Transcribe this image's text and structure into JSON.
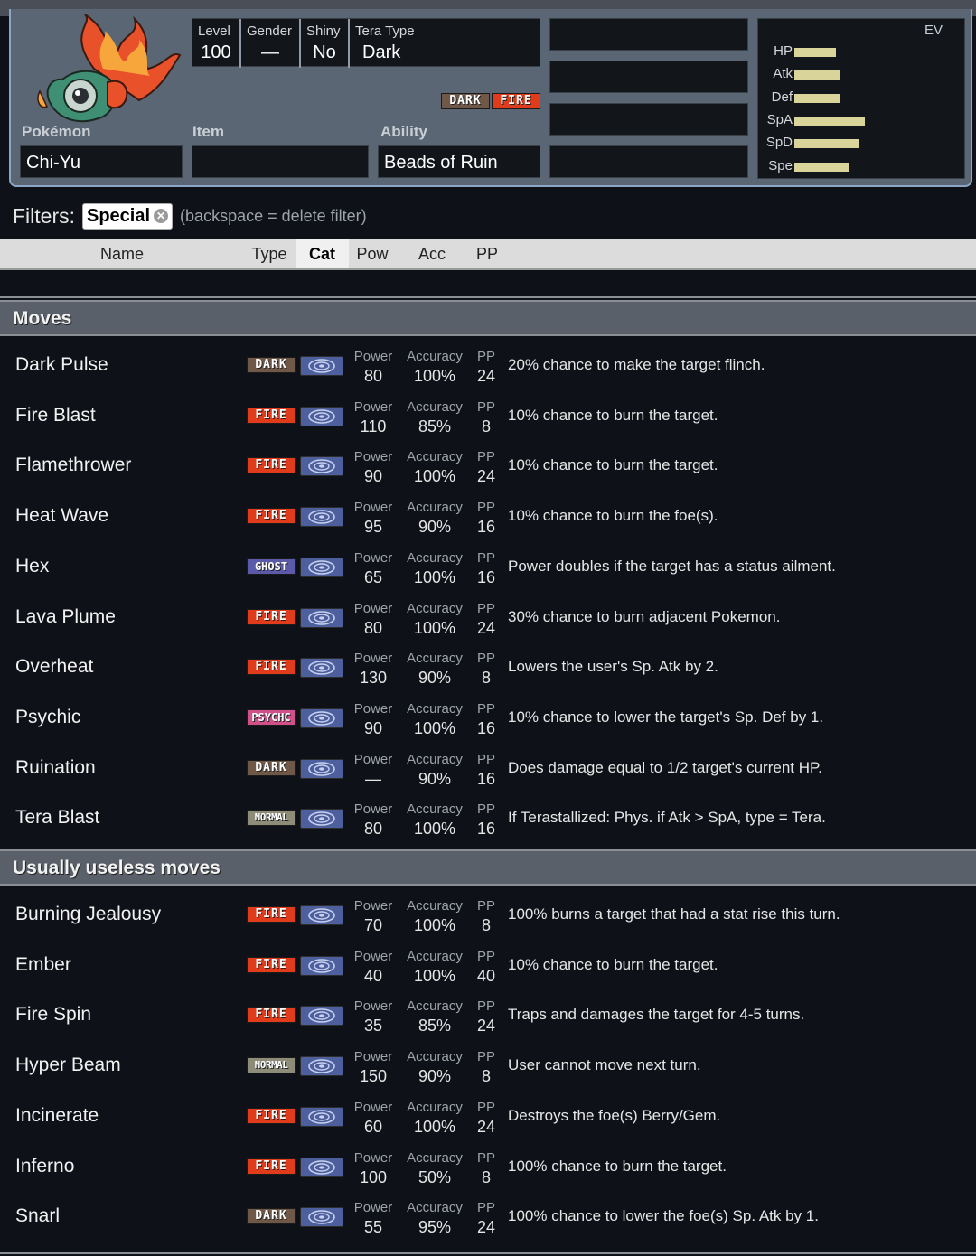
{
  "pokemon": {
    "label_pokemon": "Pokémon",
    "name": "Chi-Yu",
    "label_item": "Item",
    "item": "",
    "label_ability": "Ability",
    "ability": "Beads of Ruin",
    "types": [
      "DARK",
      "FIRE"
    ]
  },
  "details": {
    "level_label": "Level",
    "level": "100",
    "gender_label": "Gender",
    "gender": "—",
    "shiny_label": "Shiny",
    "shiny": "No",
    "tera_label": "Tera Type",
    "tera": "Dark"
  },
  "evs": {
    "header": "EV",
    "stats": [
      {
        "label": "HP",
        "level": 0.27
      },
      {
        "label": "Atk",
        "level": 0.3
      },
      {
        "label": "Def",
        "level": 0.3
      },
      {
        "label": "SpA",
        "level": 0.46
      },
      {
        "label": "SpD",
        "level": 0.42
      },
      {
        "label": "Spe",
        "level": 0.36
      }
    ]
  },
  "filters": {
    "label": "Filters:",
    "chip": "Special",
    "hint": "(backspace = delete filter)"
  },
  "sort": {
    "name": "Name",
    "type": "Type",
    "cat": "Cat",
    "pow": "Pow",
    "acc": "Acc",
    "pp": "PP"
  },
  "stat_labels": {
    "power": "Power",
    "accuracy": "Accuracy",
    "pp": "PP"
  },
  "sections": [
    {
      "title": "Moves",
      "moves": [
        {
          "name": "Dark Pulse",
          "type": "DARK",
          "power": "80",
          "accuracy": "100%",
          "pp": "24",
          "desc": "20% chance to make the target flinch."
        },
        {
          "name": "Fire Blast",
          "type": "FIRE",
          "power": "110",
          "accuracy": "85%",
          "pp": "8",
          "desc": "10% chance to burn the target."
        },
        {
          "name": "Flamethrower",
          "type": "FIRE",
          "power": "90",
          "accuracy": "100%",
          "pp": "24",
          "desc": "10% chance to burn the target."
        },
        {
          "name": "Heat Wave",
          "type": "FIRE",
          "power": "95",
          "accuracy": "90%",
          "pp": "16",
          "desc": "10% chance to burn the foe(s)."
        },
        {
          "name": "Hex",
          "type": "GHOST",
          "power": "65",
          "accuracy": "100%",
          "pp": "16",
          "desc": "Power doubles if the target has a status ailment."
        },
        {
          "name": "Lava Plume",
          "type": "FIRE",
          "power": "80",
          "accuracy": "100%",
          "pp": "24",
          "desc": "30% chance to burn adjacent Pokemon."
        },
        {
          "name": "Overheat",
          "type": "FIRE",
          "power": "130",
          "accuracy": "90%",
          "pp": "8",
          "desc": "Lowers the user's Sp. Atk by 2."
        },
        {
          "name": "Psychic",
          "type": "PSYCHC",
          "power": "90",
          "accuracy": "100%",
          "pp": "16",
          "desc": "10% chance to lower the target's Sp. Def by 1."
        },
        {
          "name": "Ruination",
          "type": "DARK",
          "power": "—",
          "accuracy": "90%",
          "pp": "16",
          "desc": "Does damage equal to 1/2 target's current HP."
        },
        {
          "name": "Tera Blast",
          "type": "NORMAL",
          "power": "80",
          "accuracy": "100%",
          "pp": "16",
          "desc": "If Terastallized: Phys. if Atk > SpA, type = Tera."
        }
      ]
    },
    {
      "title": "Usually useless moves",
      "moves": [
        {
          "name": "Burning Jealousy",
          "type": "FIRE",
          "power": "70",
          "accuracy": "100%",
          "pp": "8",
          "desc": "100% burns a target that had a stat rise this turn."
        },
        {
          "name": "Ember",
          "type": "FIRE",
          "power": "40",
          "accuracy": "100%",
          "pp": "40",
          "desc": "10% chance to burn the target."
        },
        {
          "name": "Fire Spin",
          "type": "FIRE",
          "power": "35",
          "accuracy": "85%",
          "pp": "24",
          "desc": "Traps and damages the target for 4-5 turns."
        },
        {
          "name": "Hyper Beam",
          "type": "NORMAL",
          "power": "150",
          "accuracy": "90%",
          "pp": "8",
          "desc": "User cannot move next turn."
        },
        {
          "name": "Incinerate",
          "type": "FIRE",
          "power": "60",
          "accuracy": "100%",
          "pp": "24",
          "desc": "Destroys the foe(s) Berry/Gem."
        },
        {
          "name": "Inferno",
          "type": "FIRE",
          "power": "100",
          "accuracy": "50%",
          "pp": "8",
          "desc": "100% chance to burn the target."
        },
        {
          "name": "Snarl",
          "type": "DARK",
          "power": "55",
          "accuracy": "95%",
          "pp": "24",
          "desc": "100% chance to lower the foe(s) Sp. Atk by 1."
        }
      ]
    }
  ],
  "colors": {
    "dark": "#705848",
    "fire": "#e03c1c",
    "ghost": "#5a5aa8",
    "psychic": "#d0508a",
    "normal": "#8c8c78",
    "special_icon": "#4d5f9c",
    "ev_bar": "#d9d59a",
    "panel": "#5a6674",
    "panel_border": "#8aa6c4"
  },
  "icons": {
    "category": "special-category-icon",
    "chip_remove": "close-circle-icon"
  }
}
